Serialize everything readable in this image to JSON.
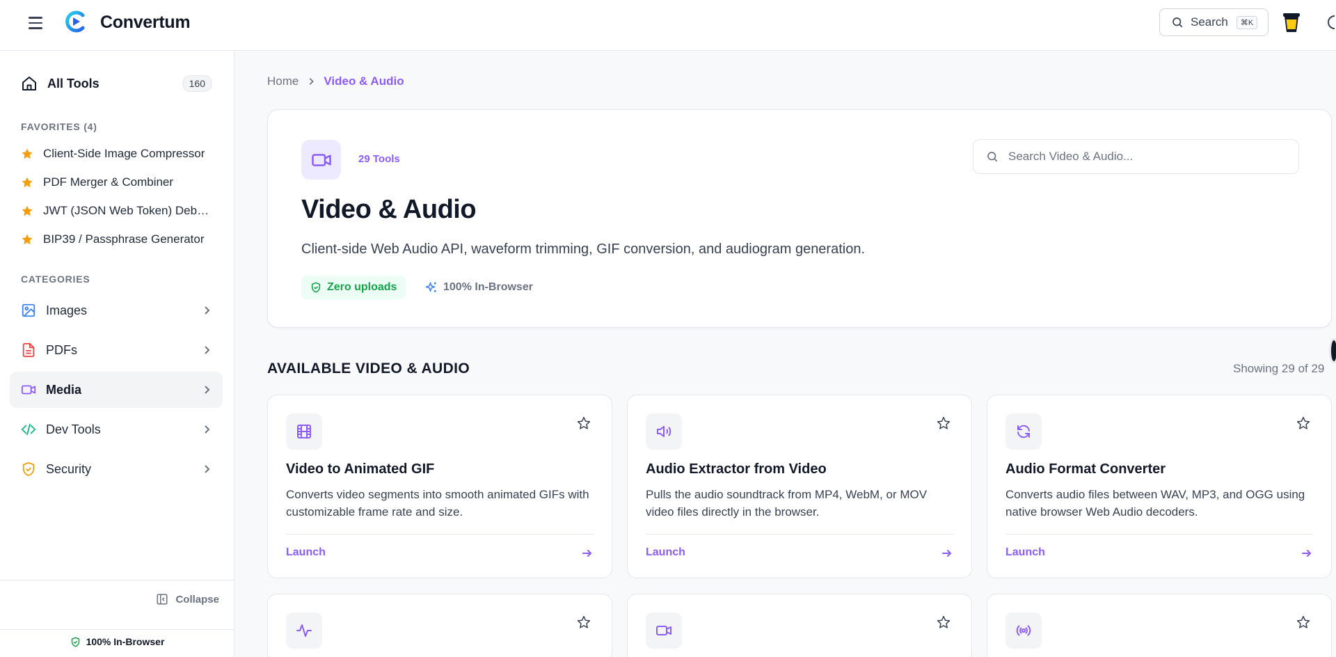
{
  "header": {
    "brand": "Convertum",
    "search_label": "Search",
    "search_shortcut": "⌘K"
  },
  "sidebar": {
    "all_tools_label": "All Tools",
    "all_tools_count": "160",
    "favorites_title": "FAVORITES (4)",
    "favorites": [
      {
        "label": "Client-Side Image Compressor"
      },
      {
        "label": "PDF Merger & Combiner"
      },
      {
        "label": "JWT (JSON Web Token) Debugger"
      },
      {
        "label": "BIP39 / Passphrase Generator"
      }
    ],
    "categories_title": "CATEGORIES",
    "categories": [
      {
        "label": "Images",
        "icon": "image-icon",
        "color": "#3b82f6"
      },
      {
        "label": "PDFs",
        "icon": "pdf-icon",
        "color": "#ef4444"
      },
      {
        "label": "Media",
        "icon": "video-icon",
        "color": "#8b5cf6",
        "active": true
      },
      {
        "label": "Dev Tools",
        "icon": "code-icon",
        "color": "#10b981"
      },
      {
        "label": "Security",
        "icon": "shield-icon",
        "color": "#f59e0b"
      }
    ],
    "collapse_label": "Collapse",
    "footer_label": "100% In-Browser"
  },
  "breadcrumb": {
    "home": "Home",
    "current": "Video & Audio"
  },
  "hero": {
    "tools_count": "29 Tools",
    "title": "Video & Audio",
    "description": "Client-side Web Audio API, waveform trimming, GIF conversion, and audiogram generation.",
    "badge_uploads": "Zero uploads",
    "badge_browser": "100% In-Browser",
    "search_placeholder": "Search Video & Audio..."
  },
  "tools_section": {
    "title": "AVAILABLE VIDEO & AUDIO",
    "showing": "Showing 29 of 29",
    "cards": [
      {
        "title": "Video to Animated GIF",
        "description": "Converts video segments into smooth animated GIFs with customizable frame rate and size.",
        "launch": "Launch",
        "icon": "film-icon"
      },
      {
        "title": "Audio Extractor from Video",
        "description": "Pulls the audio soundtrack from MP4, WebM, or MOV video files directly in the browser.",
        "launch": "Launch",
        "icon": "speaker-icon"
      },
      {
        "title": "Audio Format Converter",
        "description": "Converts audio files between WAV, MP3, and OGG using native browser Web Audio decoders.",
        "launch": "Launch",
        "icon": "refresh-icon"
      },
      {
        "title": "",
        "description": "",
        "launch": "",
        "icon": "waveform-icon"
      },
      {
        "title": "",
        "description": "",
        "launch": "",
        "icon": "video-icon"
      },
      {
        "title": "",
        "description": "",
        "launch": "",
        "icon": "broadcast-icon"
      }
    ]
  },
  "colors": {
    "accent": "#8b5cf6",
    "star": "#f59e0b",
    "green": "#16a34a"
  }
}
